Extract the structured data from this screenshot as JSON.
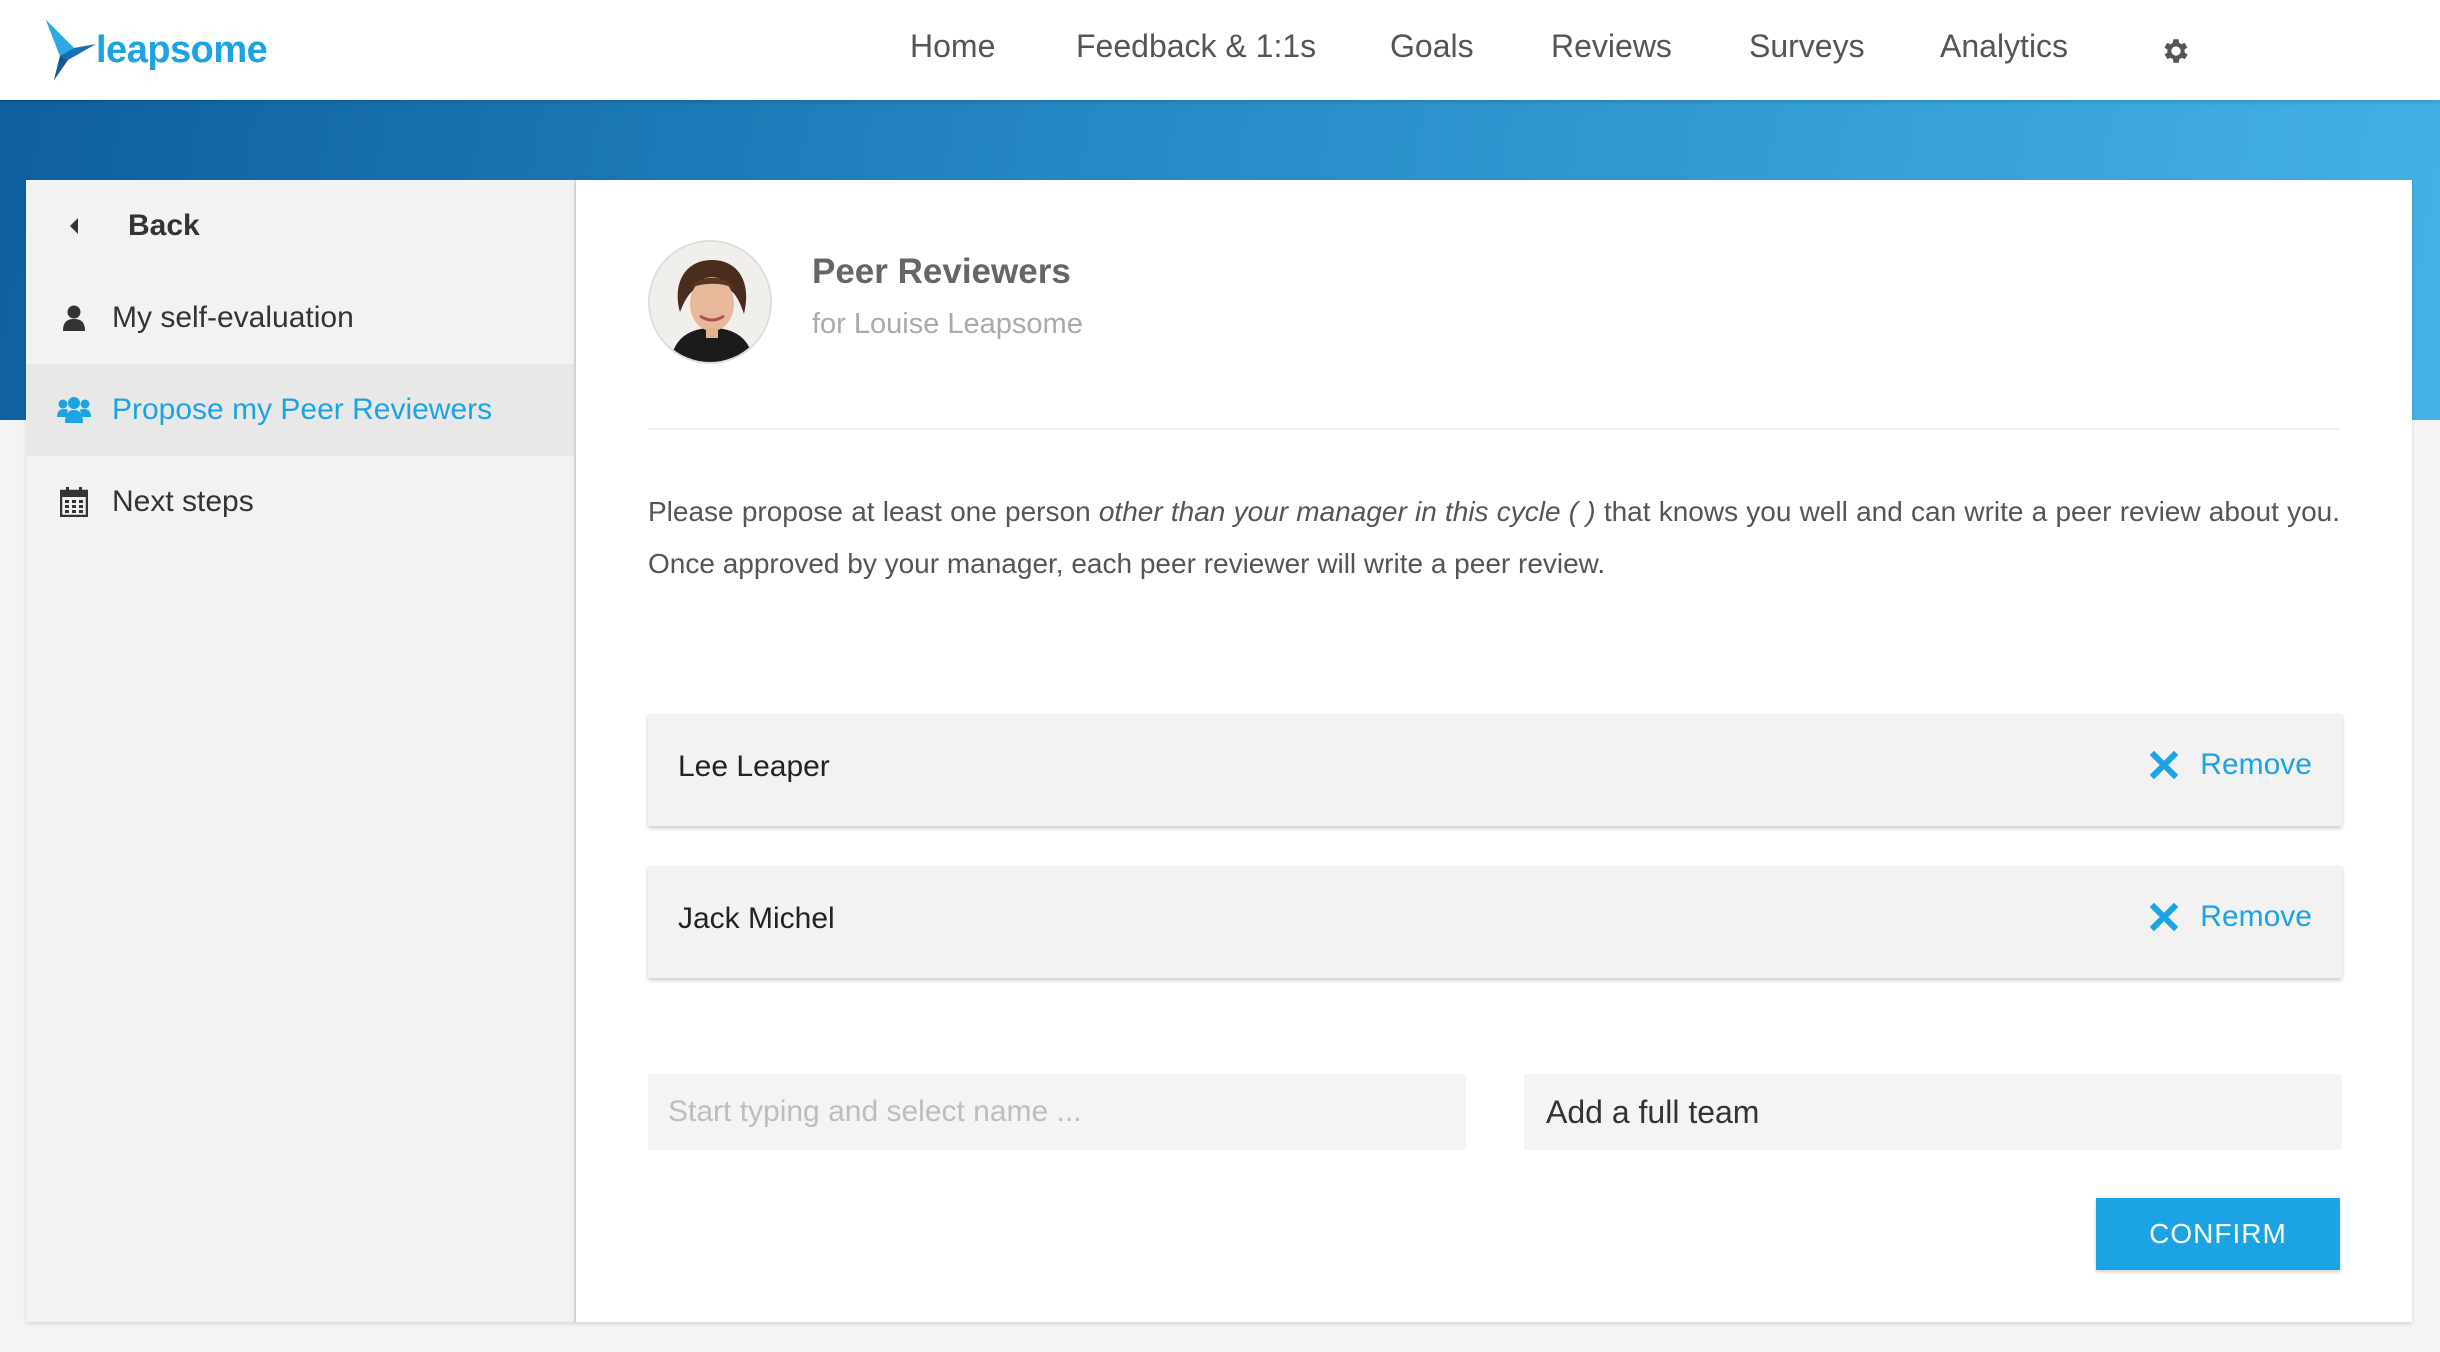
{
  "app": {
    "brand": "leapsome",
    "accent_color": "#1ba3e3"
  },
  "nav": {
    "items": [
      {
        "label": "Home"
      },
      {
        "label": "Feedback & 1:1s"
      },
      {
        "label": "Goals"
      },
      {
        "label": "Reviews"
      },
      {
        "label": "Surveys"
      },
      {
        "label": "Analytics"
      }
    ],
    "settings_icon": "gear-icon"
  },
  "sidebar": {
    "back_label": "Back",
    "items": [
      {
        "label": "My self-evaluation",
        "icon": "user-icon"
      },
      {
        "label": "Propose my Peer Reviewers",
        "icon": "users-icon",
        "active": true
      },
      {
        "label": "Next steps",
        "icon": "calendar-icon"
      }
    ]
  },
  "main": {
    "title": "Peer Reviewers",
    "subtitle": "for Louise Leapsome",
    "instructions": {
      "before": "Please propose at least one person ",
      "emphasis": "other than your manager in this cycle ( )",
      "after": " that knows you well and can write a peer review about you. Once approved by your manager, each peer reviewer will write a peer review."
    },
    "reviewers": [
      {
        "name": "Lee Leaper",
        "remove_label": "Remove"
      },
      {
        "name": "Jack Michel",
        "remove_label": "Remove"
      }
    ],
    "search": {
      "placeholder": "Start typing and select name ...",
      "value": ""
    },
    "team_select": {
      "label": "Add a full team"
    },
    "confirm_label": "CONFIRM"
  }
}
